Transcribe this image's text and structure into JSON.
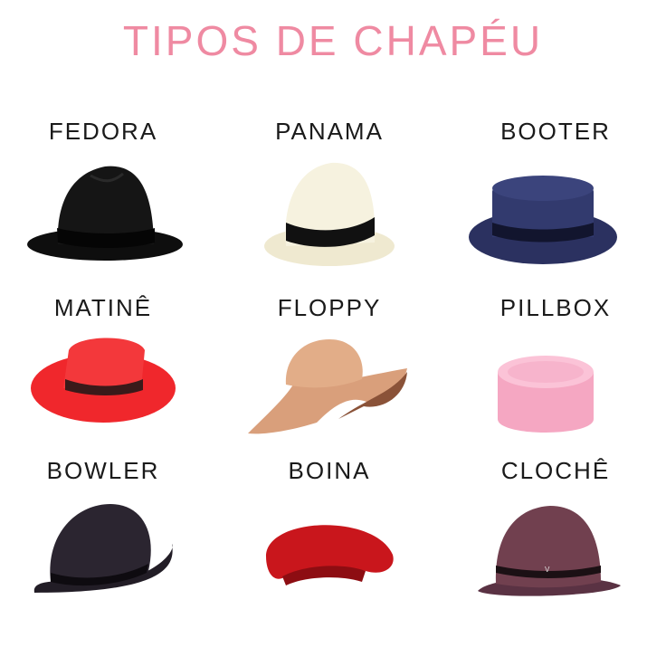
{
  "title": "TIPOS DE CHAPÉU",
  "colors": {
    "title": "#ef8aa2",
    "label": "#1a1a1a",
    "background": "#ffffff"
  },
  "hats": [
    {
      "name": "FEDORA",
      "icon": "fedora-hat-icon",
      "color": "#111111"
    },
    {
      "name": "PANAMA",
      "icon": "panama-hat-icon",
      "color": "#f4efd9"
    },
    {
      "name": "BOOTER",
      "icon": "porkpie-hat-icon",
      "color": "#2e3563"
    },
    {
      "name": "MATINÊ",
      "icon": "wide-brim-hat-icon",
      "color": "#f02a2f"
    },
    {
      "name": "FLOPPY",
      "icon": "floppy-hat-icon",
      "color": "#d9a07c"
    },
    {
      "name": "PILLBOX",
      "icon": "pillbox-hat-icon",
      "color": "#f5a9c4"
    },
    {
      "name": "BOWLER",
      "icon": "bowler-hat-icon",
      "color": "#2a2530"
    },
    {
      "name": "BOINA",
      "icon": "beret-icon",
      "color": "#c8141a"
    },
    {
      "name": "CLOCHÊ",
      "icon": "cloche-hat-icon",
      "color": "#6e3f52"
    }
  ]
}
